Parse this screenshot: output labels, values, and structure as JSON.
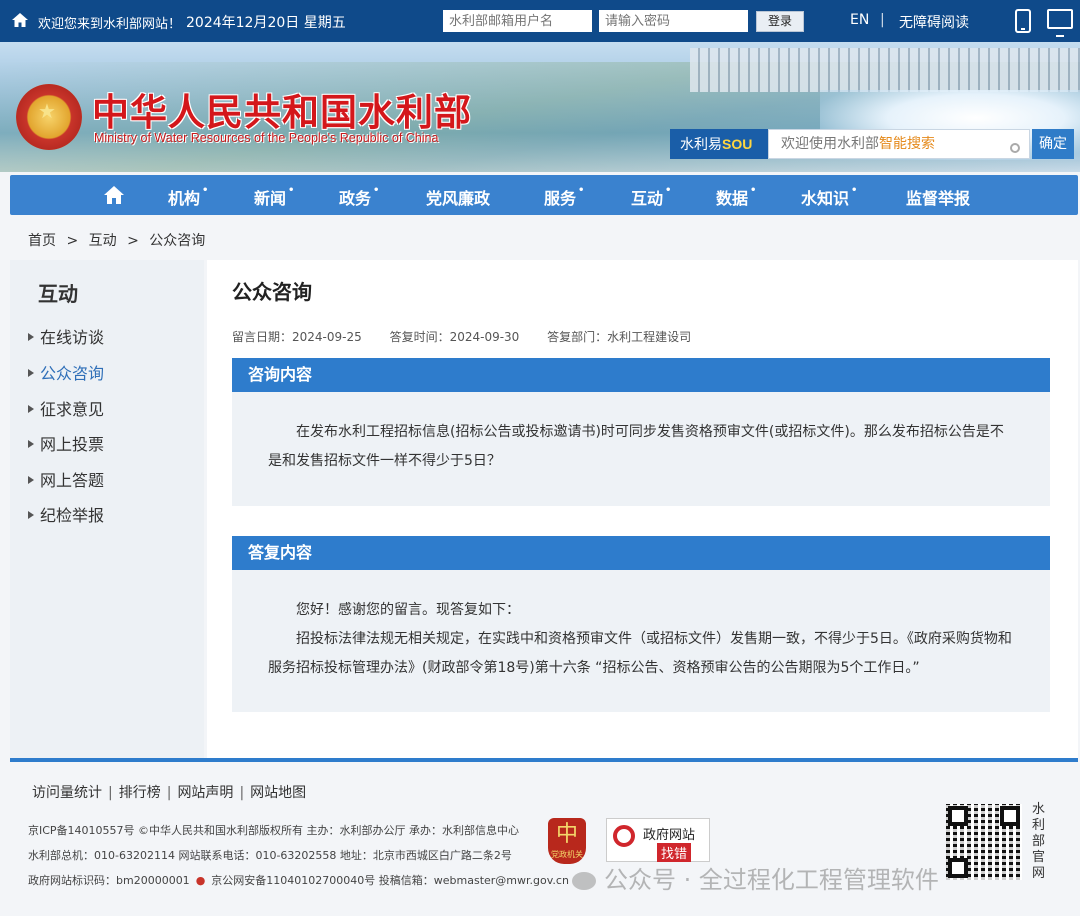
{
  "topbar": {
    "welcome": "欢迎您来到水利部网站！",
    "date": "2024年12月20日 星期五",
    "user_placeholder": "水利部邮箱用户名",
    "pwd_placeholder": "请输入密码",
    "login_label": "登录",
    "en_label": "EN",
    "separator": "|",
    "accessibility_label": "无障碍阅读"
  },
  "banner": {
    "cn_title": "中华人民共和国水利部",
    "en_title": "Ministry of Water Resources of the People's Republic of China",
    "search_brand_cn": "水利易",
    "search_brand_en": "SOU",
    "search_placeholder_plain": "欢迎使用水利部",
    "search_placeholder_highlight": "智能搜索",
    "search_button": "确定"
  },
  "nav": {
    "items": [
      {
        "label": "机构",
        "dot": "•"
      },
      {
        "label": "新闻",
        "dot": "•"
      },
      {
        "label": "政务",
        "dot": "•"
      },
      {
        "label": "党风廉政",
        "dot": ""
      },
      {
        "label": "服务",
        "dot": "•"
      },
      {
        "label": "互动",
        "dot": "•"
      },
      {
        "label": "数据",
        "dot": "•"
      },
      {
        "label": "水知识",
        "dot": "•"
      },
      {
        "label": "监督举报",
        "dot": ""
      }
    ]
  },
  "breadcrumb": {
    "items": [
      "首页",
      "互动",
      "公众咨询"
    ],
    "separator": ">"
  },
  "sidebar": {
    "title": "互动",
    "items": [
      {
        "label": "在线访谈"
      },
      {
        "label": "公众咨询"
      },
      {
        "label": "征求意见"
      },
      {
        "label": "网上投票"
      },
      {
        "label": "网上答题"
      },
      {
        "label": "纪检举报"
      }
    ]
  },
  "main": {
    "title": "公众咨询",
    "meta": {
      "message_date": "留言日期：2024-09-25",
      "reply_date": "答复时间：2024-09-30",
      "reply_dept": "答复部门：水利工程建设司"
    },
    "consult": {
      "heading": "咨询内容",
      "text": "在发布水利工程招标信息(招标公告或投标邀请书)时可同步发售资格预审文件(或招标文件)。那么发布招标公告是不是和发售招标文件一样不得少于5日？"
    },
    "reply": {
      "heading": "答复内容",
      "line1": "您好！感谢您的留言。现答复如下：",
      "line2": "招投标法律法规无相关规定，在实践中和资格预审文件（或招标文件）发售期一致，不得少于5日。《政府采购货物和服务招标投标管理办法》(财政部令第18号)第十六条 “招标公告、资格预审公告的公告期限为5个工作日。”"
    }
  },
  "footer": {
    "links": [
      "访问量统计",
      "排行榜",
      "网站声明",
      "网站地图"
    ],
    "link_separator": "|",
    "info1": "京ICP备14010557号 ©中华人民共和国水利部版权所有  主办：水利部办公厅  承办：水利部信息中心",
    "info2": "水利部总机：010-63202114  网站联系电话：010-63202558  地址：北京市西城区白广路二条2号",
    "info3a": "政府网站标识码：bm20000001",
    "info3b": "京公网安备11040102700040号  投稿信箱：webmaster@mwr.gov.cn",
    "badge_red_char": "中",
    "badge_red_text": "党政机关",
    "gov_badge_line1": "政府网站",
    "gov_badge_line2": "找错",
    "wechat_text": "公众号 · 全过程化工程管理软件",
    "qr_caption": "水利部官网"
  },
  "colors": {
    "topbar": "#0f4a8a",
    "nav": "#3a82cf",
    "section_head": "#2e7ccc",
    "title_red": "#d4171b",
    "active_link": "#2f6fb8"
  }
}
